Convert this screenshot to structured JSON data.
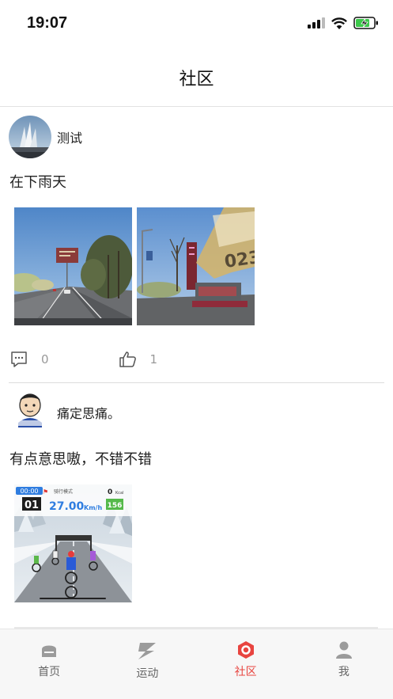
{
  "status": {
    "time": "19:07",
    "icons": [
      "cellular-signal-icon",
      "wifi-icon",
      "battery-charging-icon"
    ]
  },
  "nav": {
    "title": "社区"
  },
  "posts": [
    {
      "username": "测试",
      "text": "在下雨天",
      "photos": [
        "road-photo",
        "street-sign-photo"
      ],
      "comment_count": "0",
      "like_count": "1"
    },
    {
      "username": "痛定思痛。",
      "text": "有点意思嗷，不错不错",
      "photos": [
        "cycling-game-photo"
      ],
      "game_overlay": {
        "time": "00:00",
        "rank": "01",
        "mode": "骑行模式",
        "speed": "27.00",
        "speed_unit": "Km/h",
        "kcal_value": "0",
        "kcal_unit": "Kcal",
        "heart_rate": "156"
      }
    }
  ],
  "tabs": [
    {
      "label": "首页",
      "icon": "home-icon",
      "active": false
    },
    {
      "label": "运动",
      "icon": "sport-icon",
      "active": false
    },
    {
      "label": "社区",
      "icon": "community-icon",
      "active": true
    },
    {
      "label": "我",
      "icon": "profile-icon",
      "active": false
    }
  ],
  "colors": {
    "accent": "#e8443f",
    "tab_inactive": "#8a8a8a"
  }
}
